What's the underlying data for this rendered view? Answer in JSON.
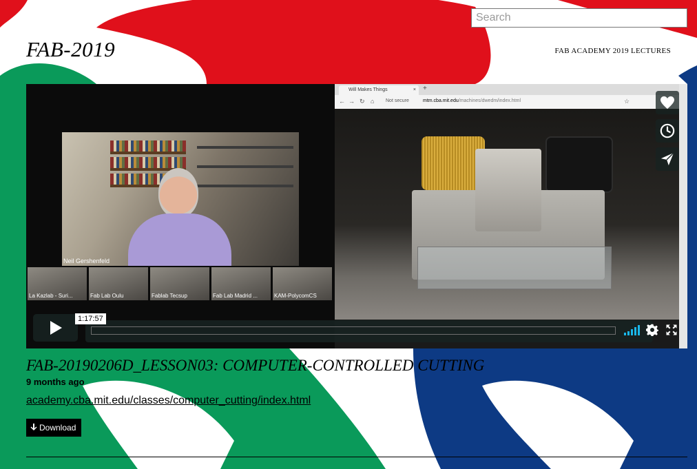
{
  "search": {
    "placeholder": "Search",
    "value": ""
  },
  "header": {
    "site_title": "FAB-2019",
    "site_subtitle": "FAB ACADEMY 2019 LECTURES"
  },
  "video": {
    "webcam_label": "Neil Gershenfeld",
    "participants": [
      "La Kazlab - Suri...",
      "Fab Lab Oulu",
      "Fablab Tecsup",
      "Fab Lab Madrid ...",
      "KAM-PolycomCS"
    ],
    "browser": {
      "tab_title": "Will Makes Things",
      "security_label": "Not secure",
      "url_domain": "mtm.cba.mit.edu",
      "url_path": "/machines/dwedm/index.html"
    },
    "timecode": "1:17:57",
    "progress": 0.0
  },
  "overlay_actions": [
    {
      "name": "like",
      "icon": "heart-icon"
    },
    {
      "name": "watch-later",
      "icon": "clock-icon"
    },
    {
      "name": "share",
      "icon": "paper-plane-icon"
    }
  ],
  "controls": {
    "icons": [
      "play-icon",
      "volume-icon",
      "settings-icon",
      "fullscreen-icon"
    ]
  },
  "content": {
    "title": "FAB-20190206D_LESSON03: COMPUTER-CONTROLLED CUTTING",
    "age": "9 months ago",
    "link": "academy.cba.mit.edu/classes/computer_cutting/index.html",
    "download_label": "Download"
  },
  "colors": {
    "red": "#e0101b",
    "green": "#0a9a5a",
    "blue": "#0d3a84",
    "control_bg": "#172322",
    "accent": "#1ab7ea"
  }
}
